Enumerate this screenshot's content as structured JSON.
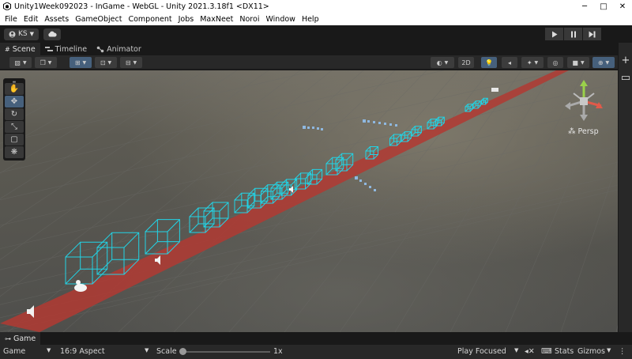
{
  "window": {
    "title": "Unity1Week092023 - InGame - WebGL - Unity 2021.3.18f1 <DX11>",
    "minimize": "─",
    "maximize": "□",
    "close": "✕"
  },
  "menu": [
    "File",
    "Edit",
    "Assets",
    "GameObject",
    "Component",
    "Jobs",
    "MaxNeet",
    "Noroi",
    "Window",
    "Help"
  ],
  "toolbar": {
    "account": "KS"
  },
  "tabs": [
    {
      "label": "Scene"
    },
    {
      "label": "Timeline"
    },
    {
      "label": "Animator"
    }
  ],
  "scene_toolbar": {
    "mode_2d": "2D"
  },
  "viewport": {
    "projection": "Persp"
  },
  "game_tab": {
    "label": "Game"
  },
  "game_toolbar": {
    "display": "Game",
    "aspect": "16:9 Aspect",
    "scale_label": "Scale",
    "scale_value": "1x",
    "play_mode": "Play Focused",
    "stats": "Stats",
    "gizmos": "Gizmos"
  },
  "colors": {
    "cube_wire": "#22d4e6",
    "red_lane": "#b23a32",
    "panel_dark": "#191919",
    "panel": "#282828",
    "accent": "#46607c"
  }
}
